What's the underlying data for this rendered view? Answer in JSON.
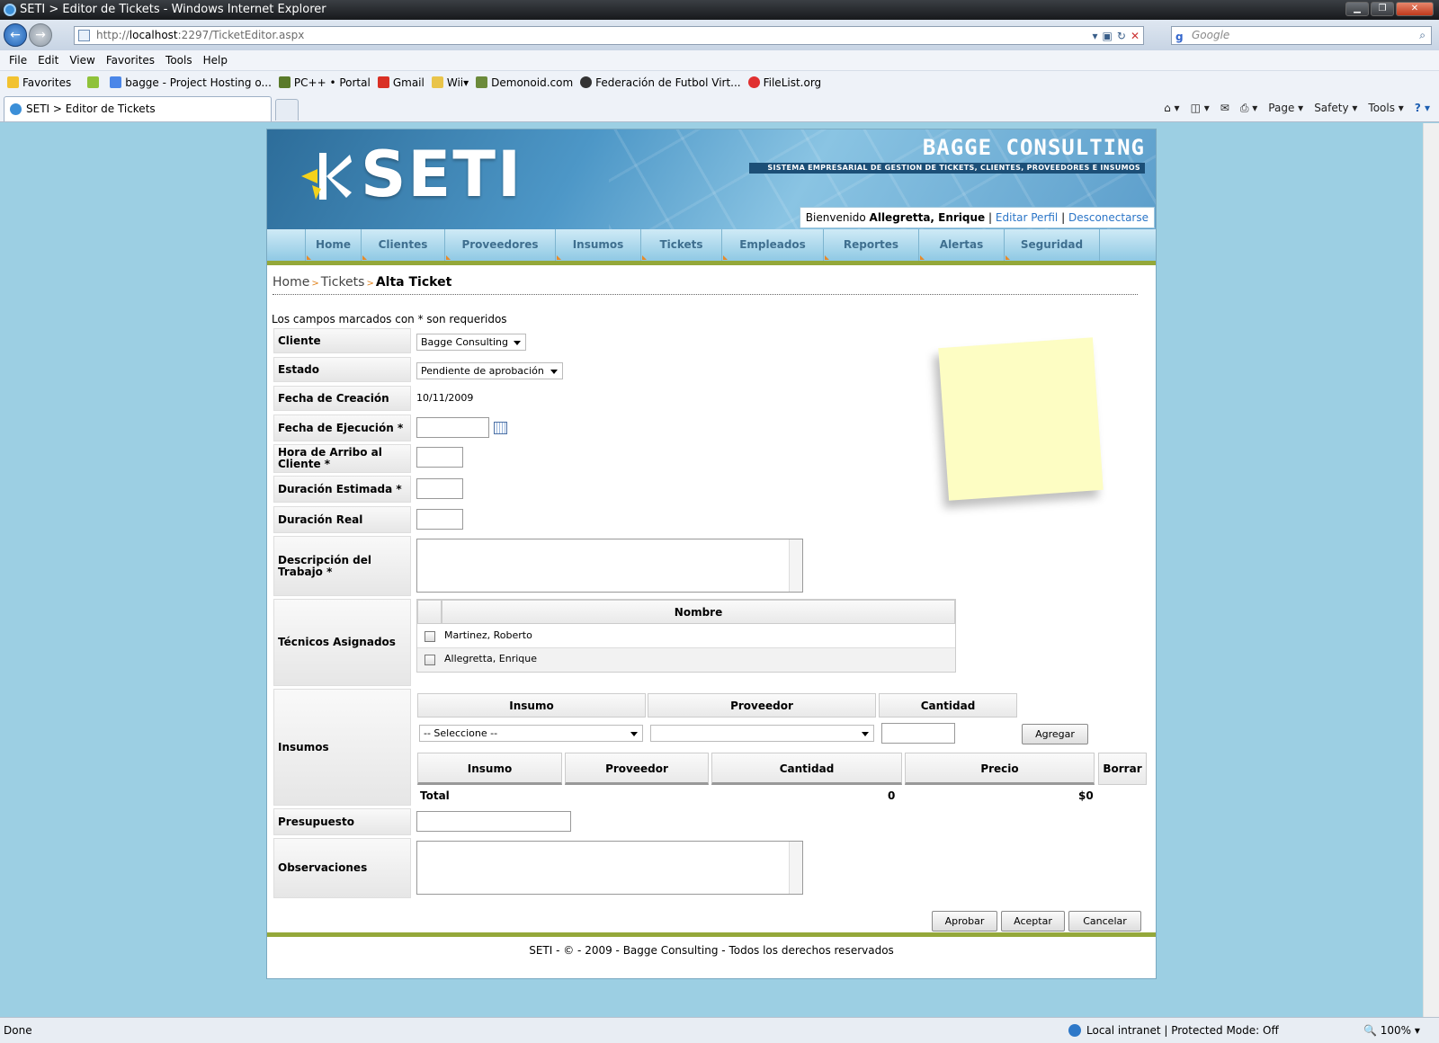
{
  "browser": {
    "title": "SETI > Editor de Tickets - Windows Internet Explorer",
    "url_prefix": "http://",
    "url_host": "localhost",
    "url_rest": ":2297/TicketEditor.aspx",
    "search_placeholder": "Google",
    "menu": [
      "File",
      "Edit",
      "View",
      "Favorites",
      "Tools",
      "Help"
    ],
    "favorites_label": "Favorites",
    "favorites": [
      "bagge - Project Hosting o...",
      "PC++ • Portal",
      "Gmail",
      "Wii",
      "Demonoid.com",
      "Federación de Futbol Virt...",
      "FileList.org"
    ],
    "tab_title": "SETI > Editor de Tickets",
    "commands": [
      "Page",
      "Safety",
      "Tools"
    ],
    "status_left": "Done",
    "status_zone": "Local intranet | Protected Mode: Off",
    "zoom": "100%"
  },
  "site": {
    "logo": "SETI",
    "brand": "BAGGE CONSULTING",
    "brand_subtitle": "SISTEMA EMPRESARIAL DE GESTION DE TICKETS, CLIENTES, PROVEEDORES E INSUMOS",
    "welcome_prefix": "Bienvenido",
    "user": "Allegretta, Enrique",
    "edit_profile": "Editar Perfil",
    "logout": "Desconectarse",
    "separator": "|",
    "nav": [
      "Home",
      "Clientes",
      "Proveedores",
      "Insumos",
      "Tickets",
      "Empleados",
      "Reportes",
      "Alertas",
      "Seguridad"
    ],
    "breadcrumb": [
      "Home",
      "Tickets",
      "Alta Ticket"
    ],
    "footer": "SETI - © - 2009 - Bagge Consulting - Todos los derechos reservados"
  },
  "form": {
    "required_note": "Los campos marcados con * son requeridos",
    "labels": {
      "cliente": "Cliente",
      "estado": "Estado",
      "fecha_creacion": "Fecha de Creación",
      "fecha_ejecucion": "Fecha de Ejecución *",
      "hora_arribo": "Hora de Arribo al Cliente *",
      "duracion_estimada": "Duración Estimada *",
      "duracion_real": "Duración Real",
      "descripcion": "Descripción del Trabajo *",
      "tecnicos": "Técnicos Asignados",
      "insumos": "Insumos",
      "presupuesto": "Presupuesto",
      "observaciones": "Observaciones"
    },
    "cliente_value": "Bagge Consulting",
    "estado_value": "Pendiente de aprobación",
    "fecha_creacion_value": "10/11/2009",
    "tecnicos_header": "Nombre",
    "tecnicos": [
      "Martinez, Roberto",
      "Allegretta, Enrique"
    ],
    "insumos_add_headers": [
      "Insumo",
      "Proveedor",
      "Cantidad"
    ],
    "insumo_select": "-- Seleccione --",
    "agregar": "Agregar",
    "insumos_list_headers": [
      "Insumo",
      "Proveedor",
      "Cantidad",
      "Precio",
      "Borrar"
    ],
    "total_label": "Total",
    "total_cantidad": "0",
    "total_precio": "$0",
    "buttons": {
      "aprobar": "Aprobar",
      "aceptar": "Aceptar",
      "cancelar": "Cancelar"
    }
  }
}
